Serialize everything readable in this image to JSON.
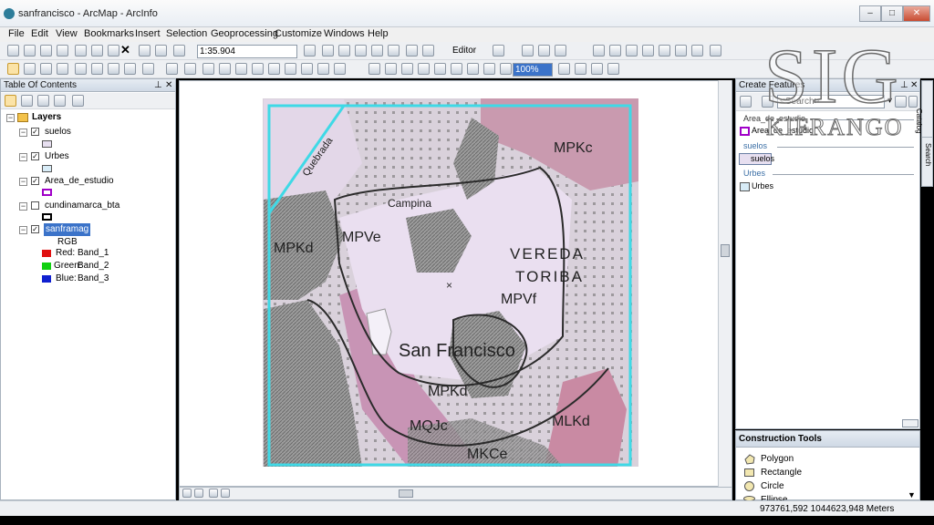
{
  "window": {
    "title": "sanfrancisco - ArcMap - ArcInfo",
    "controls": [
      "–",
      "□",
      "✕"
    ]
  },
  "menubar": [
    "File",
    "Edit",
    "View",
    "Bookmarks",
    "Insert",
    "Selection",
    "Geoprocessing",
    "Customize",
    "Windows",
    "Help"
  ],
  "toolbar": {
    "scale": "1:35.904",
    "editor_label": "Editor",
    "zoom_percent": "100%"
  },
  "toc": {
    "title": "Table Of Contents",
    "pin": "⌂",
    "close": "✕",
    "root": "Layers",
    "layers": [
      {
        "name": "suelos",
        "checked": true,
        "swatch": "#e7dff0",
        "swatch_border": "#555"
      },
      {
        "name": "Urbes",
        "checked": true,
        "swatch": "#d8ecf7",
        "swatch_border": "#555"
      },
      {
        "name": "Area_de_estudio",
        "checked": true,
        "swatch": "#ffffff",
        "swatch_border": "#a000c8"
      },
      {
        "name": "cundinamarca_bta",
        "checked": false,
        "swatch": "#ffffff",
        "swatch_border": "#000000"
      },
      {
        "name": "sanframag",
        "checked": true,
        "selected": true
      }
    ],
    "raster": {
      "label": "RGB",
      "bands": [
        {
          "label": "Red:",
          "value": "Band_1",
          "color": "#e01010"
        },
        {
          "label": "Green:",
          "value": "Band_2",
          "color": "#10d010"
        },
        {
          "label": "Blue:",
          "value": "Band_3",
          "color": "#1020d0"
        }
      ]
    }
  },
  "map_labels": [
    "MPKc",
    "MPKd",
    "MPVe",
    "VEREDA",
    "TORIBA",
    "MPVf",
    "San Francisco",
    "MPKd",
    "MQJc",
    "MLKd",
    "MKCe",
    "Campina",
    "Quebrada"
  ],
  "create_features": {
    "title": "Create Features",
    "search_placeholder": "<Search>",
    "groups": [
      {
        "name": "Area_de_estudio",
        "template": "Area_de_estudio",
        "swatch": "#ffffff",
        "swatch_border": "#a000c8"
      },
      {
        "name": "suelos",
        "template": "suelos",
        "swatch": "#e7dff0",
        "swatch_border": "#555"
      },
      {
        "name": "Urbes",
        "template": "Urbes",
        "swatch": "#d8ecf7",
        "swatch_border": "#555"
      }
    ]
  },
  "construction_tools": {
    "title": "Construction Tools",
    "items": [
      "Polygon",
      "Rectangle",
      "Circle",
      "Ellipse"
    ]
  },
  "side_tabs": [
    "Catalog",
    "Search"
  ],
  "watermark": {
    "big": "SIG",
    "small": "KIFRANGO"
  },
  "status": {
    "coordinates": "973761,592  1044623,948 Meters"
  }
}
